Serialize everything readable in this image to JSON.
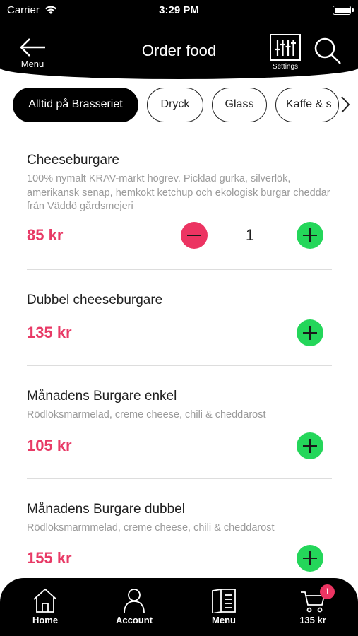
{
  "status_bar": {
    "carrier": "Carrier",
    "time": "3:29 PM"
  },
  "header": {
    "back_label": "Menu",
    "title": "Order food",
    "settings_label": "Settings"
  },
  "categories": [
    {
      "label": "Alltid på Brasseriet",
      "active": true
    },
    {
      "label": "Dryck",
      "active": false
    },
    {
      "label": "Glass",
      "active": false
    },
    {
      "label": "Kaffe & s",
      "active": false
    }
  ],
  "items": [
    {
      "name": "Cheeseburgare",
      "description": "100% nymalt KRAV-märkt högrev. Picklad gurka, silverlök, amerikansk senap, hemkokt ketchup och ekologisk burgar cheddar från Väddö gårdsmejeri",
      "price": "85 kr",
      "quantity": "1"
    },
    {
      "name": "Dubbel cheeseburgare",
      "description": "",
      "price": "135 kr",
      "quantity": ""
    },
    {
      "name": "Månadens Burgare enkel",
      "description": "Rödlöksmarmelad, creme cheese, chili & cheddarost",
      "price": "105 kr",
      "quantity": ""
    },
    {
      "name": "Månadens Burgare dubbel",
      "description": "Rödlöksmarmmelad, creme cheese, chili & cheddarost",
      "price": "155 kr",
      "quantity": ""
    }
  ],
  "tabbar": {
    "home": "Home",
    "account": "Account",
    "menu": "Menu",
    "cart": "135 kr",
    "cart_badge": "1"
  },
  "colors": {
    "accent_price": "#e83a66",
    "plus": "#24d65a",
    "minus": "#ec3462"
  }
}
